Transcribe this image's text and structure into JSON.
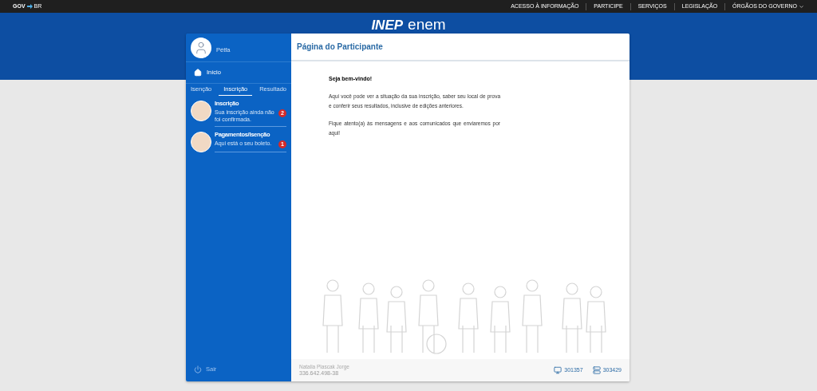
{
  "gov_bar": {
    "brand_left": "GOV",
    "brand_right": "BR",
    "links": [
      {
        "label": "ACESSO À INFORMAÇÃO",
        "dropdown": false
      },
      {
        "label": "PARTICIPE",
        "dropdown": false
      },
      {
        "label": "SERVIÇOS",
        "dropdown": false
      },
      {
        "label": "LEGISLAÇÃO",
        "dropdown": false
      },
      {
        "label": "ÓRGÃOS DO GOVERNO",
        "dropdown": true
      }
    ]
  },
  "logo": {
    "left": "INEP",
    "right": "enem"
  },
  "sidebar": {
    "user_name": "Pétfa",
    "home": "Início",
    "tabs": [
      {
        "label": "Isenção",
        "selected": false
      },
      {
        "label": "Inscrição",
        "selected": true
      },
      {
        "label": "Resultado",
        "selected": false
      }
    ],
    "notifications": [
      {
        "title": "Inscrição",
        "text": "Sua inscrição ainda não foi confirmada.",
        "count": "2"
      },
      {
        "title": "Pagamentos/Isenção",
        "text": "Aqui está o seu boleto.",
        "count": "1"
      }
    ],
    "logout": "Sair"
  },
  "main": {
    "title": "Página do Participante",
    "greeting": "Seja bem-vindo!",
    "paragraphs": [
      "Aqui você pode ver a situação da sua inscrição, saber seu local de prova e conferir seus resultados, inclusive de edições anteriores.",
      "Fique atento(a) às mensagens e aos comunicados que enviaremos por aqui!"
    ]
  },
  "footer": {
    "name": "Natalia Plascak Jorge",
    "cpf": "336.642.498-38",
    "stats": [
      {
        "kind": "monitor",
        "value": "301357"
      },
      {
        "kind": "server",
        "value": "303429"
      }
    ]
  }
}
